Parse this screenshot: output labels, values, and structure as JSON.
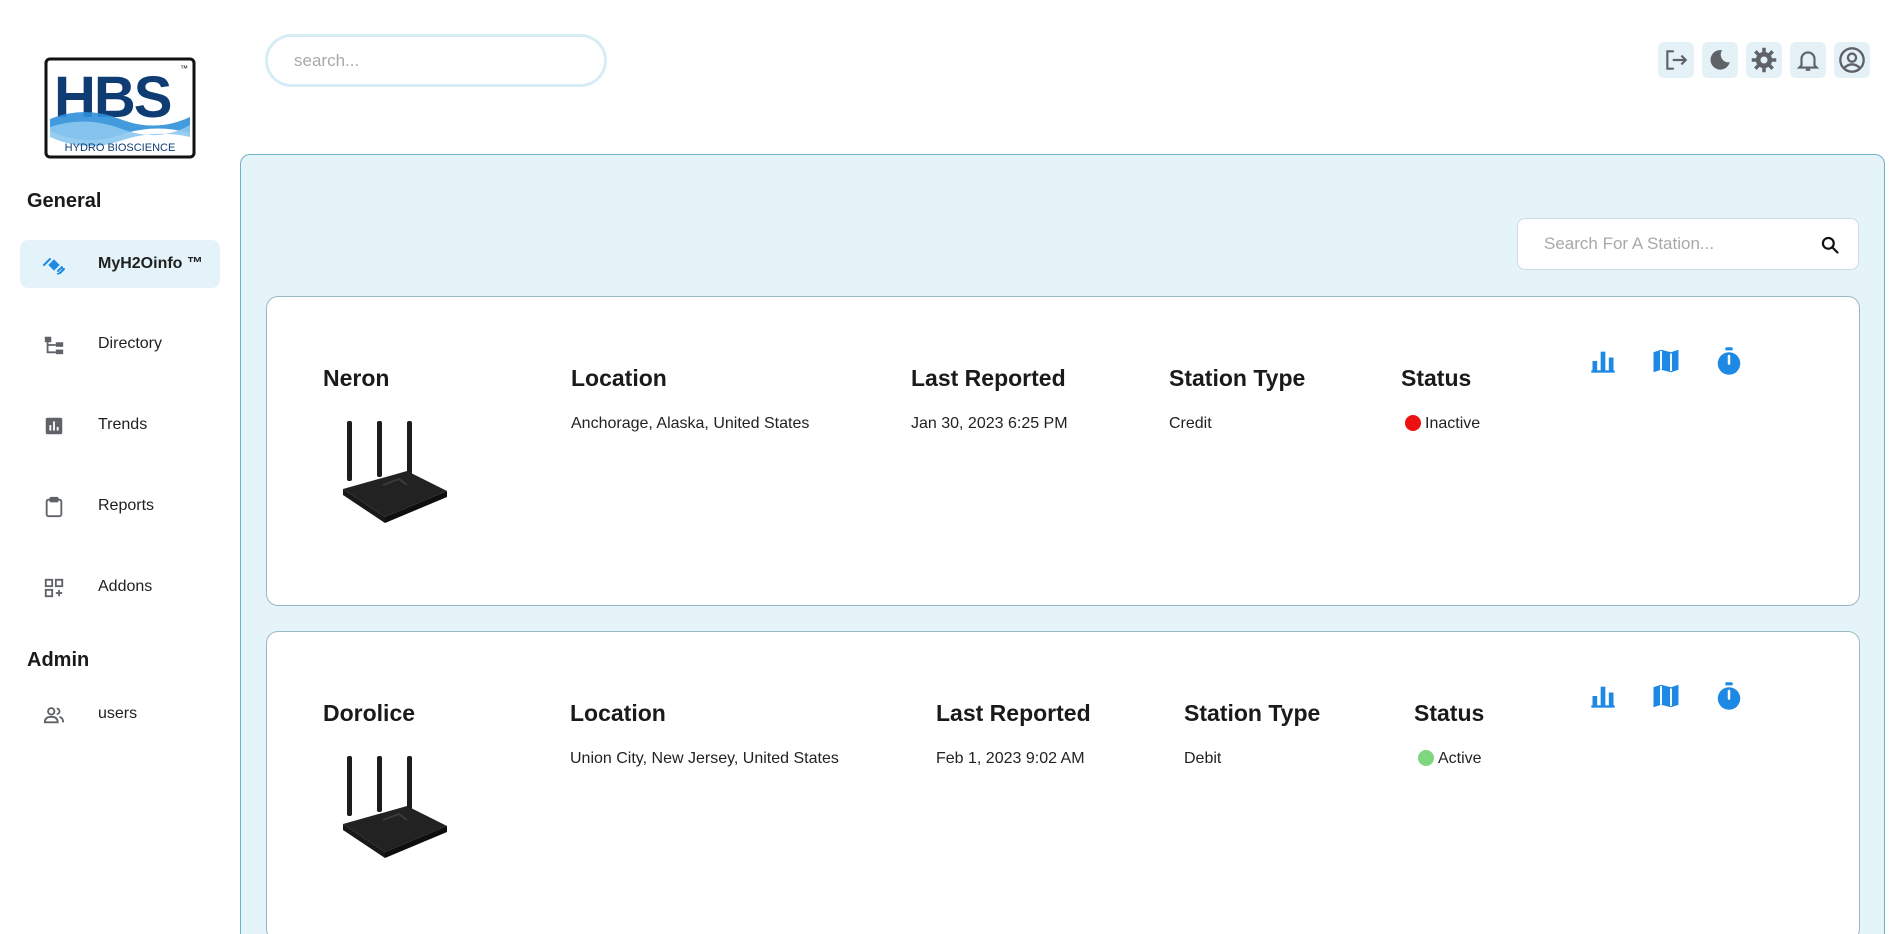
{
  "logo": {
    "text": "HBS",
    "subtitle": "HYDRO BIOSCIENCE"
  },
  "sidebar": {
    "general_title": "General",
    "admin_title": "Admin",
    "items": [
      {
        "label": "MyH2Oinfo ™",
        "icon": "satellite-icon",
        "active": true
      },
      {
        "label": "Directory",
        "icon": "directory-tree-icon"
      },
      {
        "label": "Trends",
        "icon": "chart-icon"
      },
      {
        "label": "Reports",
        "icon": "clipboard-icon"
      },
      {
        "label": "Addons",
        "icon": "addons-grid-icon"
      }
    ],
    "admin_items": [
      {
        "label": "users",
        "icon": "users-icon"
      }
    ]
  },
  "header": {
    "search_placeholder": "search...",
    "icons": [
      "logout-icon",
      "dark-mode-icon",
      "settings-icon",
      "notifications-icon",
      "account-icon"
    ]
  },
  "station_search": {
    "placeholder": "Search For A Station..."
  },
  "columns": {
    "location": "Location",
    "last_reported": "Last Reported",
    "station_type": "Station Type",
    "status": "Status"
  },
  "stations": [
    {
      "name": "Neron",
      "location": "Anchorage, Alaska, United States",
      "last_reported": "Jan 30, 2023 6:25 PM",
      "station_type": "Credit",
      "status": "Inactive",
      "status_color": "#ee1111"
    },
    {
      "name": "Dorolice",
      "location": "Union City, New Jersey, United States",
      "last_reported": "Feb 1, 2023 9:02 AM",
      "station_type": "Debit",
      "status": "Active",
      "status_color": "#7ed67e"
    }
  ],
  "colors": {
    "accent": "#1e88e5",
    "panel_bg": "#e4f4f9",
    "active_nav": "#e3f3f9"
  }
}
